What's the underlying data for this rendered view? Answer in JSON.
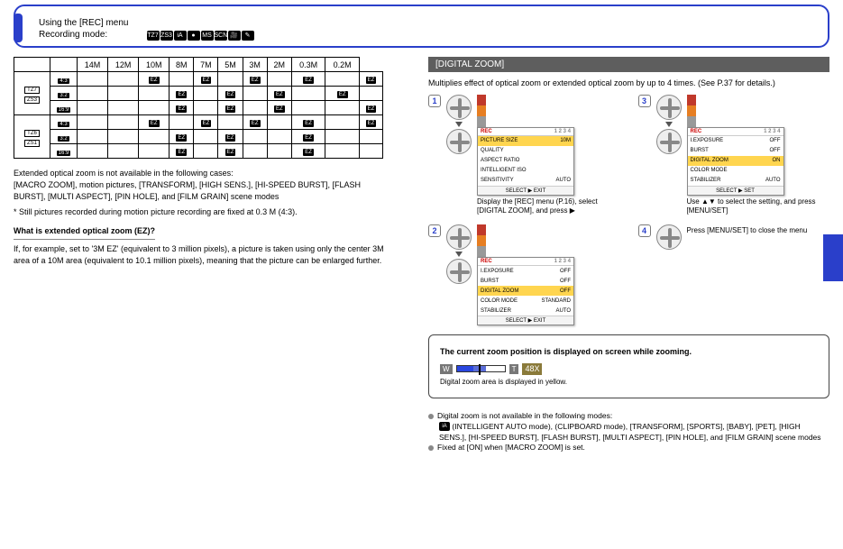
{
  "header": {
    "line1": "Using the [REC] menu",
    "line2_prefix": "Recording mode: ",
    "mode_icons": [
      "TZ7",
      "ZS3",
      "iA",
      "●",
      "MS",
      "SCN",
      "🎥",
      "✎"
    ]
  },
  "size_table": {
    "col_headers": [
      "14M",
      "12M",
      "10M",
      "8M",
      "7M",
      "5M",
      "3M",
      "2M",
      "0.3M",
      "0.2M"
    ],
    "row_groups": [
      {
        "group_badges": [
          "TZ7",
          "ZS3"
        ],
        "rows": [
          {
            "ratio": "4:3",
            "cells": [
              "",
              "",
              "EZ",
              "",
              "EZ",
              "",
              "EZ",
              "",
              "EZ",
              "",
              "EZ"
            ]
          },
          {
            "ratio": "3:2",
            "cells": [
              "",
              "",
              "",
              "EZ",
              "",
              "EZ",
              "",
              "EZ",
              "",
              "EZ",
              ""
            ]
          },
          {
            "ratio": "16:9",
            "cells": [
              "",
              "",
              "",
              "EZ",
              "",
              "EZ",
              "",
              "EZ",
              "",
              "",
              "EZ"
            ]
          }
        ]
      },
      {
        "group_badges": [
          "TZ6",
          "ZS1"
        ],
        "rows": [
          {
            "ratio": "4:3",
            "cells": [
              "",
              "",
              "EZ",
              "",
              "EZ",
              "",
              "EZ",
              "",
              "EZ",
              "",
              "EZ"
            ]
          },
          {
            "ratio": "3:2",
            "cells": [
              "",
              "",
              "",
              "EZ",
              "",
              "EZ",
              "",
              "",
              "EZ",
              "",
              ""
            ]
          },
          {
            "ratio": "16:9",
            "cells": [
              "",
              "",
              "",
              "EZ",
              "",
              "EZ",
              "",
              "",
              "EZ",
              "",
              ""
            ]
          }
        ]
      }
    ]
  },
  "left_notes": {
    "bullets": [
      "Extended optical zoom is not available in the following cases:",
      "[MACRO ZOOM], motion pictures, [TRANSFORM], [HIGH SENS.], [HI-SPEED BURST], [FLASH BURST], [MULTI ASPECT], [PIN HOLE], and [FILM GRAIN] scene modes",
      "* Still pictures recorded during motion picture recording are fixed at 0.3 M (4:3)."
    ],
    "ref_head": "What is extended optical zoom (EZ)?",
    "ref_body": "If, for example, set to '3M EZ' (equivalent to 3 million pixels), a picture is taken using only the center 3M area of a 10M area (equivalent to 10.1 million pixels), meaning that the picture can be enlarged further."
  },
  "right": {
    "section_title": "[DIGITAL ZOOM]",
    "intro": "Multiplies effect of optical zoom or extended optical zoom by up to 4 times. (See P.37 for details.)",
    "steps": [
      {
        "num": "1",
        "menu": {
          "title": "REC",
          "page": "1 2 3 4",
          "rows": [
            {
              "label": "PICTURE SIZE",
              "val": "10M",
              "sel": true
            },
            {
              "label": "QUALITY",
              "val": "",
              "sel": false
            },
            {
              "label": "ASPECT RATIO",
              "val": "",
              "sel": false
            },
            {
              "label": "INTELLIGENT ISO",
              "val": "",
              "sel": false
            },
            {
              "label": "SENSITIVITY",
              "val": "AUTO",
              "sel": false
            }
          ],
          "foot": "SELECT ▶ EXIT"
        },
        "caption": "Display the [REC] menu (P.16), select [DIGITAL ZOOM], and press ▶"
      },
      {
        "num": "3",
        "menu": {
          "title": "REC",
          "page": "1 2 3 4",
          "rows": [
            {
              "label": "I.EXPOSURE",
              "val": "OFF",
              "sel": false
            },
            {
              "label": "BURST",
              "val": "OFF",
              "sel": false
            },
            {
              "label": "DIGITAL ZOOM",
              "val": "ON",
              "sel": true
            },
            {
              "label": "COLOR MODE",
              "val": "",
              "sel": false
            },
            {
              "label": "STABILIZER",
              "val": "AUTO",
              "sel": false
            }
          ],
          "foot": "SELECT ▶ SET"
        },
        "caption": "Use ▲▼ to select the setting, and press [MENU/SET]"
      },
      {
        "num": "2",
        "menu": {
          "title": "REC",
          "page": "1 2 3 4",
          "rows": [
            {
              "label": "I.EXPOSURE",
              "val": "OFF",
              "sel": false
            },
            {
              "label": "BURST",
              "val": "OFF",
              "sel": false
            },
            {
              "label": "DIGITAL ZOOM",
              "val": "OFF",
              "sel": true
            },
            {
              "label": "COLOR MODE",
              "val": "STANDARD",
              "sel": false
            },
            {
              "label": "STABILIZER",
              "val": "AUTO",
              "sel": false
            }
          ],
          "foot": "SELECT ▶ EXIT"
        },
        "caption": ""
      },
      {
        "num": "4",
        "menu": null,
        "caption": "Press [MENU/SET] to close the menu"
      }
    ],
    "zoom_box": {
      "heading": "The current zoom position is displayed on screen while zooming.",
      "bar_left": "W",
      "bar_right": "T",
      "bar_mag": "48X",
      "caption": "Digital zoom area is displayed in yellow."
    },
    "notes": [
      "Digital zoom is not available in the following modes:",
      "  (INTELLIGENT AUTO mode), (CLIPBOARD mode), [TRANSFORM], [SPORTS], [BABY], [PET], [HIGH SENS.], [HI-SPEED BURST], [FLASH BURST], [MULTI ASPECT], [PIN HOLE], and [FILM GRAIN] scene modes",
      "Fixed at [ON] when [MACRO ZOOM] is set."
    ]
  }
}
